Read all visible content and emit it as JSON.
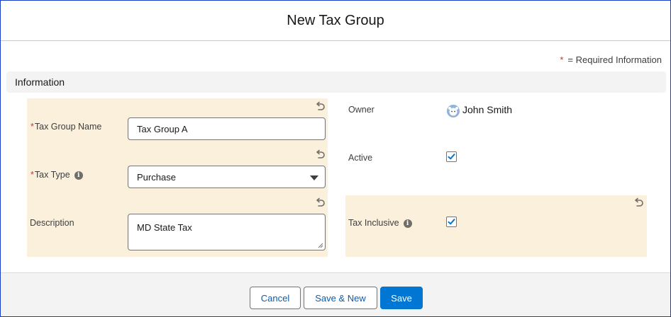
{
  "modal": {
    "title": "New Tax Group"
  },
  "required_info": {
    "marker": "*",
    "text": "= Required Information"
  },
  "section": {
    "title": "Information"
  },
  "fields": {
    "tax_group_name": {
      "required_marker": "*",
      "label": "Tax Group Name",
      "value": "Tax Group A"
    },
    "tax_type": {
      "required_marker": "*",
      "label": "Tax Type",
      "value": "Purchase"
    },
    "description": {
      "label": "Description",
      "value": "MD State Tax"
    },
    "owner": {
      "label": "Owner",
      "value": "John Smith"
    },
    "active": {
      "label": "Active",
      "checked": true
    },
    "tax_inclusive": {
      "label": "Tax Inclusive",
      "checked": true
    }
  },
  "icons": {
    "undo": "undo-icon",
    "info": "info-icon",
    "avatar": "user-avatar-icon",
    "dropdown": "chevron-down-icon",
    "check": "checkmark-icon"
  },
  "buttons": {
    "cancel": "Cancel",
    "save_new": "Save & New",
    "save": "Save"
  },
  "colors": {
    "brand": "#0176d3",
    "highlight": "#faf0dc",
    "required": "#c23934",
    "section_bg": "#f3f3f3"
  }
}
